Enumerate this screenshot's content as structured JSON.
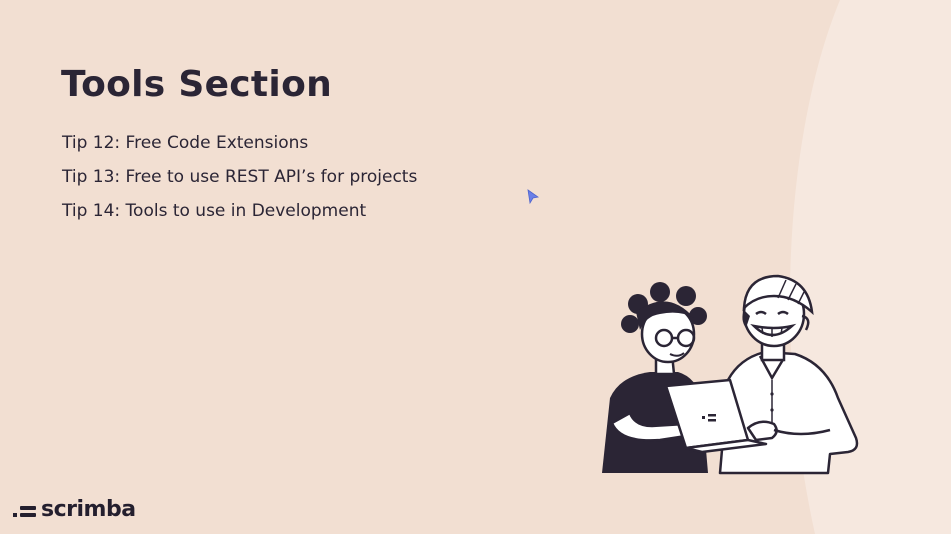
{
  "slide": {
    "title": "Tools Section",
    "tips": [
      "Tip 12: Free Code Extensions",
      "Tip 13: Free to use REST API’s for projects",
      "Tip 14: Tools to use in Development"
    ]
  },
  "brand": {
    "logo_text": "scrimba",
    "logo_icon": "scrimba-logo-icon"
  },
  "illustration": {
    "icon": "two-people-with-laptop-illustration"
  },
  "colors": {
    "background": "#f2dfd2",
    "background_curve": "#f6e8df",
    "text": "#2b2535",
    "cursor": "#6a7fe8"
  }
}
